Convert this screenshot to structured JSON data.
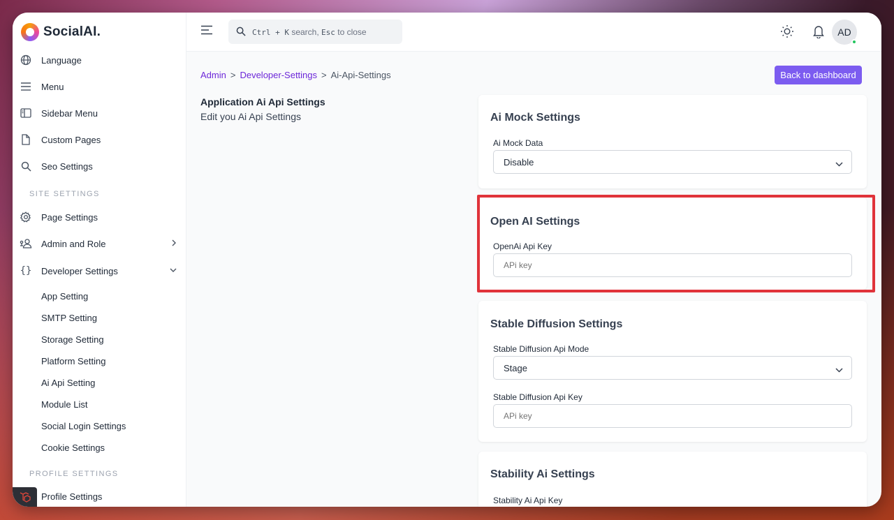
{
  "brand": {
    "name": "SocialAI."
  },
  "sidebar": {
    "items": [
      {
        "label": "Language",
        "icon": "globe-icon"
      },
      {
        "label": "Menu",
        "icon": "menu-icon"
      },
      {
        "label": "Sidebar Menu",
        "icon": "sidebar-icon"
      },
      {
        "label": "Custom Pages",
        "icon": "file-icon"
      },
      {
        "label": "Seo Settings",
        "icon": "search-icon"
      }
    ],
    "site_settings_title": "SITE SETTINGS",
    "site_items": [
      {
        "label": "Page Settings",
        "icon": "gear-icon"
      },
      {
        "label": "Admin and Role",
        "icon": "users-icon"
      },
      {
        "label": "Developer Settings",
        "icon": "braces-icon"
      }
    ],
    "developer_sub": [
      "App Setting",
      "SMTP Setting",
      "Storage Setting",
      "Platform Setting",
      "Ai Api Setting",
      "Module List",
      "Social Login Settings",
      "Cookie Settings"
    ],
    "profile_settings_title": "PROFILE SETTINGS",
    "profile_items": [
      {
        "label": "Profile Settings"
      }
    ]
  },
  "topbar": {
    "search_prefix": "Ctrl + K",
    "search_mid": "search,",
    "search_key": "Esc",
    "search_suffix": "to close",
    "avatar_initials": "AD"
  },
  "breadcrumb": {
    "items": [
      "Admin",
      "Developer-Settings",
      "Ai-Api-Settings"
    ],
    "separator": ">"
  },
  "back_button": "Back to dashboard",
  "intro": {
    "title": "Application Ai Api Settings",
    "subtitle": "Edit you Ai Api Settings"
  },
  "cards": {
    "mock": {
      "title": "Ai Mock Settings",
      "label": "Ai Mock Data",
      "value": "Disable"
    },
    "openai": {
      "title": "Open AI Settings",
      "label": "OpenAi Api Key",
      "placeholder": "APi key"
    },
    "stable": {
      "title": "Stable Diffusion Settings",
      "mode_label": "Stable Diffusion Api Mode",
      "mode_value": "Stage",
      "key_label": "Stable Diffusion Api Key",
      "key_placeholder": "APi key"
    },
    "stability": {
      "title": "Stability Ai Settings",
      "key_label": "Stability Ai Api Key"
    }
  },
  "colors": {
    "accent": "#7c5cf0",
    "link": "#6d28d9",
    "highlight": "#e0333a",
    "online": "#22c55e"
  }
}
